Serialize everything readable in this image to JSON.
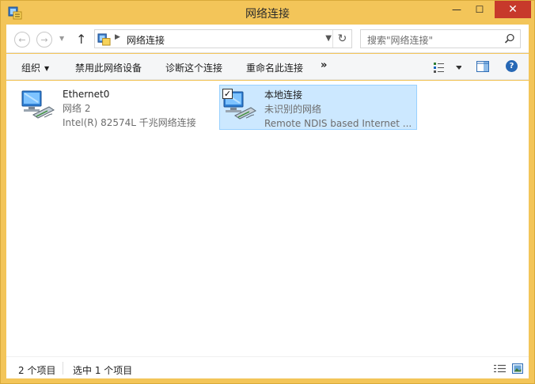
{
  "window": {
    "title": "网络连接",
    "close_glyph": "✕",
    "min_glyph": "—",
    "max_glyph": "☐"
  },
  "address": {
    "path": "网络连接",
    "search_placeholder": "搜索\"网络连接\""
  },
  "toolbar": {
    "organize": "组织",
    "disable": "禁用此网络设备",
    "diagnose": "诊断这个连接",
    "rename": "重命名此连接",
    "more": "»"
  },
  "connections": [
    {
      "name": "Ethernet0",
      "status": "网络  2",
      "device": "Intel(R) 82574L 千兆网络连接",
      "selected": false,
      "icon": "network-adapter-icon"
    },
    {
      "name": "本地连接",
      "status": "未识别的网络",
      "device": "Remote NDIS based Internet ...",
      "selected": true,
      "icon": "network-adapter-icon"
    }
  ],
  "status": {
    "item_count": "2 个项目",
    "selected_count": "选中 1 个项目"
  },
  "colors": {
    "frame": "#f3c559",
    "selection": "#cce8ff",
    "close": "#c7392b"
  }
}
